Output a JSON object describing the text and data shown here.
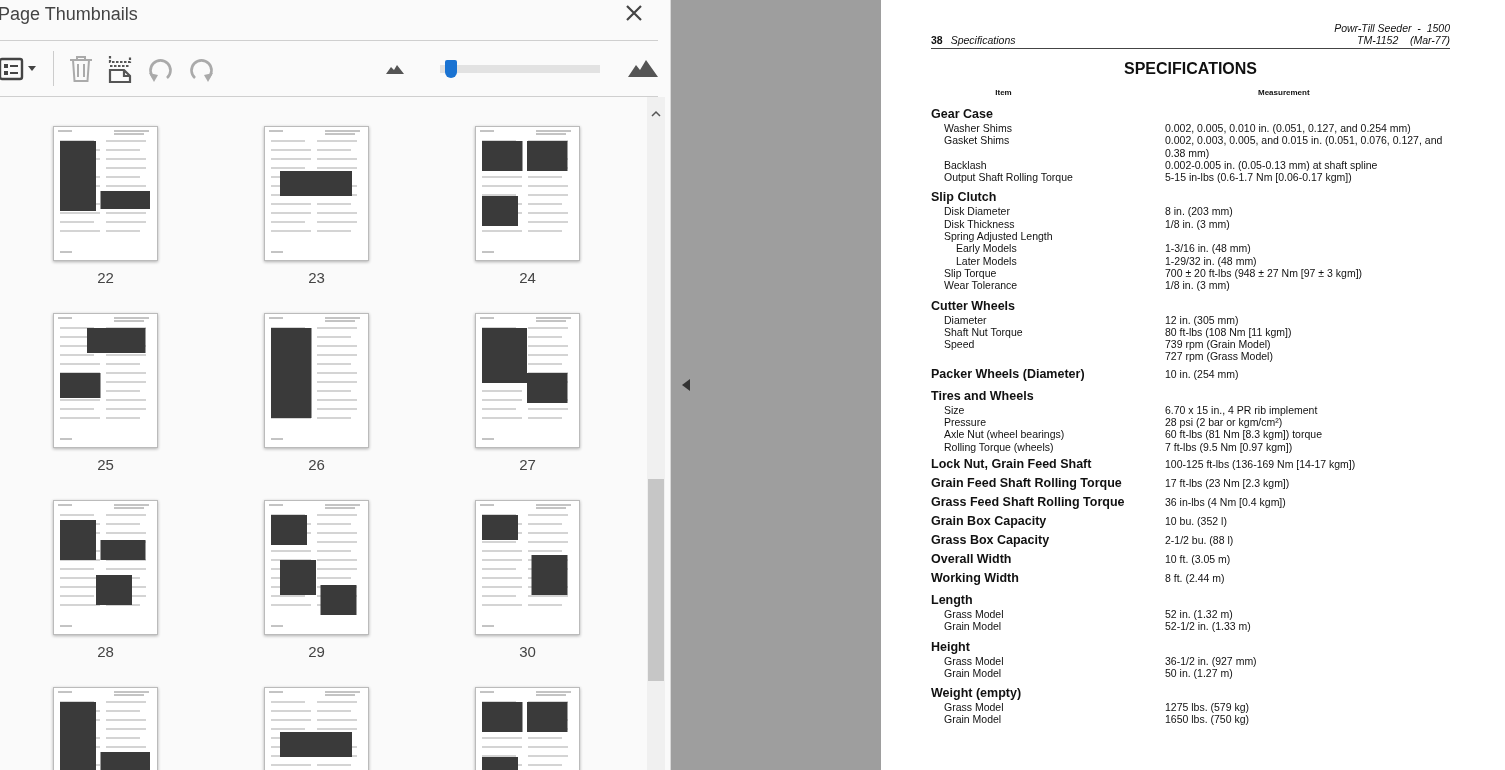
{
  "sidebar": {
    "title": "Page Thumbnails",
    "toolbar": [
      {
        "kind": "options",
        "disabled": false
      },
      {
        "kind": "delete",
        "disabled": true
      },
      {
        "kind": "extract",
        "disabled": false
      },
      {
        "kind": "rotate-left",
        "disabled": true
      },
      {
        "kind": "rotate-right",
        "disabled": true
      }
    ],
    "zoom_slider": {
      "level": 0.04
    },
    "thumbnails": [
      {
        "kind": "page",
        "label": "22"
      },
      {
        "kind": "page",
        "label": "23"
      },
      {
        "kind": "page",
        "label": "24"
      },
      {
        "kind": "page",
        "label": "25"
      },
      {
        "kind": "page",
        "label": "26"
      },
      {
        "kind": "page",
        "label": "27"
      },
      {
        "kind": "page",
        "label": "28"
      },
      {
        "kind": "page",
        "label": "29"
      },
      {
        "kind": "page",
        "label": "30"
      },
      {
        "kind": "partial"
      },
      {
        "kind": "partial"
      },
      {
        "kind": "partial"
      }
    ]
  },
  "document_page": {
    "page_number": "38",
    "section": "Specifications",
    "product": "Powr-Till Seeder  -  1500",
    "manual": "TM-1152    (Mar-77)",
    "title": "SPECIFICATIONS",
    "columns": [
      "Item",
      "Measurement"
    ],
    "sections": [
      {
        "heading": "Gear Case",
        "items": [
          {
            "label": "Washer Shims",
            "values": [
              "0.002, 0.005, 0.010 in. (0.051, 0.127, and 0.254 mm)"
            ]
          },
          {
            "label": "Gasket Shims",
            "values": [
              "0.002, 0.003, 0.005, and 0.015 in. (0.051, 0.076, 0.127, and 0.38 mm)"
            ]
          },
          {
            "label": "Backlash",
            "values": [
              "0.002-0.005 in. (0.05-0.13 mm) at shaft spline"
            ]
          },
          {
            "label": "Output Shaft Rolling Torque",
            "values": [
              "5-15 in-lbs (0.6-1.7 Nm [0.06-0.17 kgm])"
            ]
          }
        ]
      },
      {
        "heading": "Slip Clutch",
        "items": [
          {
            "label": "Disk Diameter",
            "values": [
              "8 in. (203 mm)"
            ]
          },
          {
            "label": "Disk Thickness",
            "values": [
              "1/8 in. (3 mm)"
            ]
          },
          {
            "label": "Spring Adjusted Length",
            "children": [
              {
                "label": "Early Models",
                "values": [
                  "1-3/16 in. (48 mm)"
                ]
              },
              {
                "label": "Later Models",
                "values": [
                  "1-29/32 in. (48 mm)"
                ]
              }
            ]
          },
          {
            "label": "Slip Torque",
            "values": [
              "700 ± 20 ft-lbs (948 ± 27 Nm [97 ± 3 kgm])"
            ]
          },
          {
            "label": "Wear Tolerance",
            "values": [
              "1/8 in. (3 mm)"
            ]
          }
        ]
      },
      {
        "heading": "Cutter Wheels",
        "items": [
          {
            "label": "Diameter",
            "values": [
              "12 in. (305 mm)"
            ]
          },
          {
            "label": "Shaft Nut Torque",
            "values": [
              "80 ft-lbs (108 Nm [11 kgm])"
            ]
          },
          {
            "label": "Speed",
            "values": [
              "739 rpm (Grain Model)",
              "727 rpm (Grass Model)"
            ]
          }
        ]
      },
      {
        "heading": "Packer Wheels (Diameter)",
        "value": "10 in. (254 mm)"
      },
      {
        "heading": "Tires and Wheels",
        "items": [
          {
            "label": "Size",
            "values": [
              "6.70 x 15 in., 4 PR rib implement"
            ]
          },
          {
            "label": "Pressure",
            "values": [
              "28 psi (2 bar or kgm/cm²)"
            ]
          },
          {
            "label": "Axle Nut (wheel bearings)",
            "values": [
              "60 ft-lbs (81 Nm [8.3 kgm]) torque"
            ]
          },
          {
            "label": "Rolling Torque (wheels)",
            "values": [
              "7 ft-lbs (9.5 Nm [0.97 kgm])"
            ]
          }
        ]
      },
      {
        "heading": "Lock Nut, Grain Feed Shaft",
        "value": "100-125 ft-lbs (136-169 Nm [14-17 kgm])"
      },
      {
        "heading": "Grain Feed Shaft Rolling Torque",
        "value": "17 ft-lbs (23 Nm [2.3 kgm])"
      },
      {
        "heading": "Grass Feed Shaft Rolling Torque",
        "value": "36 in-lbs (4 Nm [0.4 kgm])"
      },
      {
        "heading": "Grain Box Capacity",
        "value": "10 bu. (352 l)"
      },
      {
        "heading": "Grass Box Capacity",
        "value": "2-1/2 bu. (88 l)"
      },
      {
        "heading": "Overall Width",
        "value": "10 ft. (3.05 m)"
      },
      {
        "heading": "Working Width",
        "value": "8 ft. (2.44 m)"
      },
      {
        "heading": "Length",
        "items": [
          {
            "label": "Grass Model",
            "values": [
              "52 in. (1.32 m)"
            ]
          },
          {
            "label": "Grain Model",
            "values": [
              "52-1/2 in. (1.33 m)"
            ]
          }
        ]
      },
      {
        "heading": "Height",
        "items": [
          {
            "label": "Grass Model",
            "values": [
              "36-1/2 in. (927 mm)"
            ]
          },
          {
            "label": "Grain Model",
            "values": [
              "50 in. (1.27 m)"
            ]
          }
        ]
      },
      {
        "heading": "Weight (empty)",
        "items": [
          {
            "label": "Grass Model",
            "values": [
              "1275 lbs. (579 kg)"
            ]
          },
          {
            "label": "Grain Model",
            "values": [
              "1650 lbs. (750 kg)"
            ]
          }
        ]
      }
    ]
  }
}
